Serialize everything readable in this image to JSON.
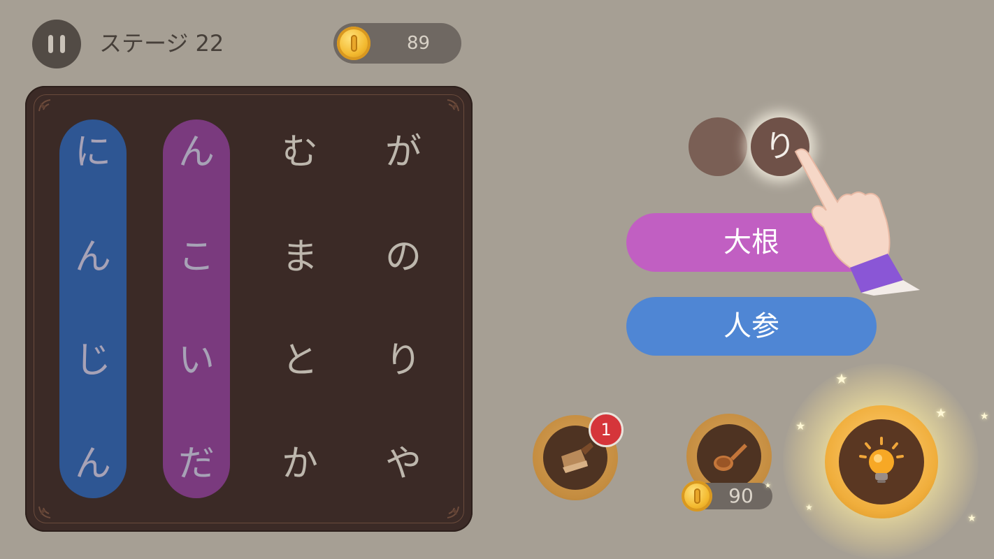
{
  "header": {
    "stage_label": "ステージ 22",
    "coins": "89"
  },
  "grid": {
    "rows": [
      [
        "に",
        "ん",
        "む",
        "が"
      ],
      [
        "ん",
        "こ",
        "ま",
        "の"
      ],
      [
        "じ",
        "い",
        "と",
        "り"
      ],
      [
        "ん",
        "だ",
        "か",
        "や"
      ]
    ]
  },
  "found_words": [
    {
      "word": "にんじん",
      "color": "#2e5693"
    },
    {
      "word": "んこいだ",
      "color": "#7a3a7e"
    }
  ],
  "current_input": {
    "slots": [
      "",
      "り"
    ]
  },
  "answers": [
    {
      "label": "大根",
      "color": "#c15fc2"
    },
    {
      "label": "人参",
      "color": "#4f86d4"
    }
  ],
  "tools": {
    "cleaver": {
      "icon": "cleaver-icon",
      "badge": "1"
    },
    "spoon": {
      "icon": "spoon-icon",
      "price": "90"
    },
    "hint": {
      "icon": "lightbulb-icon"
    }
  },
  "colors": {
    "background": "#a69f94",
    "board": "#3b2a26",
    "coin": "#f3b92f"
  }
}
